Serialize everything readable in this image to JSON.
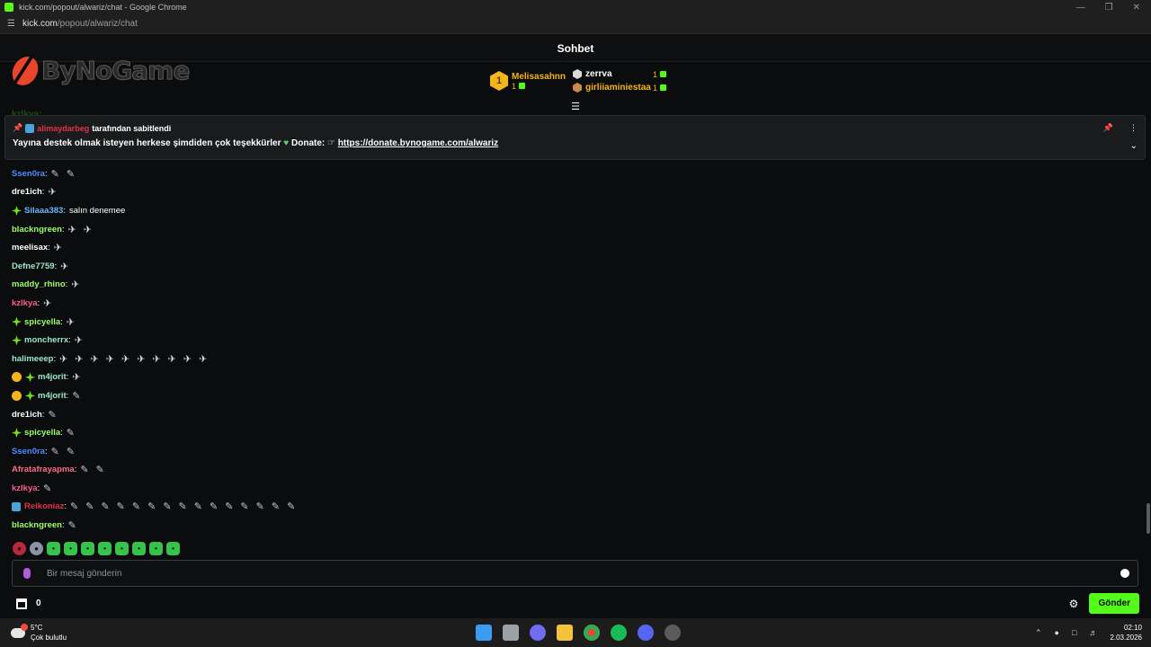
{
  "window": {
    "title": "kick.com/popout/alwariz/chat - Google Chrome",
    "url_host": "kick.com",
    "url_path": "/popout/alwariz/chat"
  },
  "header": {
    "title": "Sohbet"
  },
  "banner": {
    "logo_text": "ByNoGame",
    "leaders": [
      {
        "rank": "1",
        "name": "Melisasahnn",
        "count": "1"
      },
      {
        "name": "zerrva",
        "count": "1",
        "color": "#ffffff"
      },
      {
        "name": "girliiaminiestaa",
        "count": "1",
        "color": "#f4b41a"
      }
    ]
  },
  "pinned": {
    "pinned_by_user": "alimaydarbeg",
    "pinned_by_text": "tarafından sabitlendi",
    "message_text": "Yayına destek olmak isteyen herkese şimdiden çok teşekkürler",
    "donate_label": "Donate:",
    "link": "https://donate.bynogame.com/alwariz"
  },
  "partial_user": "kzlkya:",
  "messages": [
    {
      "user": "Ssen0ra",
      "color": "#4f8cff",
      "badges": [],
      "text": "",
      "emotes": [
        "a",
        "a"
      ]
    },
    {
      "user": "dre1ich",
      "color": "#ffffff",
      "badges": [],
      "text": "",
      "emotes": [
        "b"
      ]
    },
    {
      "user": "Silaaa383",
      "color": "#6ab7ff",
      "badges": [
        "spark"
      ],
      "text": "salın denemee",
      "emotes": []
    },
    {
      "user": "blackngreen",
      "color": "#9dff6a",
      "badges": [],
      "text": "",
      "emotes": [
        "b",
        "b"
      ]
    },
    {
      "user": "meelisax",
      "color": "#ffffff",
      "badges": [],
      "text": "",
      "emotes": [
        "b"
      ]
    },
    {
      "user": "Defne7759",
      "color": "#9de8c8",
      "badges": [],
      "text": "",
      "emotes": [
        "b"
      ]
    },
    {
      "user": "maddy_rhino",
      "color": "#9dff6a",
      "badges": [],
      "text": "",
      "emotes": [
        "b"
      ]
    },
    {
      "user": "kzlkya",
      "color": "#ff5c8a",
      "badges": [],
      "text": "",
      "emotes": [
        "b"
      ]
    },
    {
      "user": "spicyella",
      "color": "#9dff6a",
      "badges": [
        "spark"
      ],
      "text": "",
      "emotes": [
        "b"
      ]
    },
    {
      "user": "moncherrx",
      "color": "#9de8c8",
      "badges": [
        "spark"
      ],
      "text": "",
      "emotes": [
        "b"
      ]
    },
    {
      "user": "halimeeep",
      "color": "#9de8c8",
      "badges": [],
      "text": "",
      "emotes": [
        "b",
        "b",
        "b",
        "b",
        "b",
        "b",
        "b",
        "b",
        "b",
        "b"
      ]
    },
    {
      "user": "m4jorit",
      "color": "#9de8c8",
      "badges": [
        "coin",
        "spark"
      ],
      "text": "",
      "emotes": [
        "b"
      ]
    },
    {
      "user": "m4jorit",
      "color": "#9de8c8",
      "badges": [
        "coin",
        "spark"
      ],
      "text": "",
      "emotes": [
        "a"
      ]
    },
    {
      "user": "dre1ich",
      "color": "#ffffff",
      "badges": [],
      "text": "",
      "emotes": [
        "a"
      ]
    },
    {
      "user": "spicyella",
      "color": "#9dff6a",
      "badges": [
        "spark"
      ],
      "text": "",
      "emotes": [
        "a"
      ]
    },
    {
      "user": "Ssen0ra",
      "color": "#4f8cff",
      "badges": [],
      "text": "",
      "emotes": [
        "a",
        "a"
      ]
    },
    {
      "user": "Afratafrayapma",
      "color": "#ff6b8a",
      "badges": [],
      "text": "",
      "emotes": [
        "a",
        "a"
      ]
    },
    {
      "user": "kzlkya",
      "color": "#ff5c8a",
      "badges": [],
      "text": "",
      "emotes": [
        "a"
      ]
    },
    {
      "user": "Reikoniaz",
      "color": "#e43149",
      "badges": [
        "blue"
      ],
      "text": "",
      "emotes": [
        "a",
        "a",
        "a",
        "a",
        "a",
        "a",
        "a",
        "a",
        "a",
        "a",
        "a",
        "a",
        "a",
        "a",
        "a"
      ]
    },
    {
      "user": "blackngreen",
      "color": "#9dff6a",
      "badges": [],
      "text": "",
      "emotes": [
        "a"
      ]
    }
  ],
  "input": {
    "placeholder": "Bir mesaj gönderin"
  },
  "footer": {
    "points": "0",
    "send_label": "Gönder"
  },
  "taskbar": {
    "temperature": "5°C",
    "condition": "Çok bulutlu",
    "time": "02:10",
    "date": "2.03.2026",
    "apps": [
      "start-icon",
      "task-view-icon",
      "copilot-icon",
      "file-explorer-icon",
      "chrome-icon",
      "spotify-icon",
      "discord-icon",
      "clock-app-icon"
    ]
  },
  "colors": {
    "accent": "#53fc18",
    "gold": "#f4b41a",
    "background": "#0b0c0d"
  }
}
